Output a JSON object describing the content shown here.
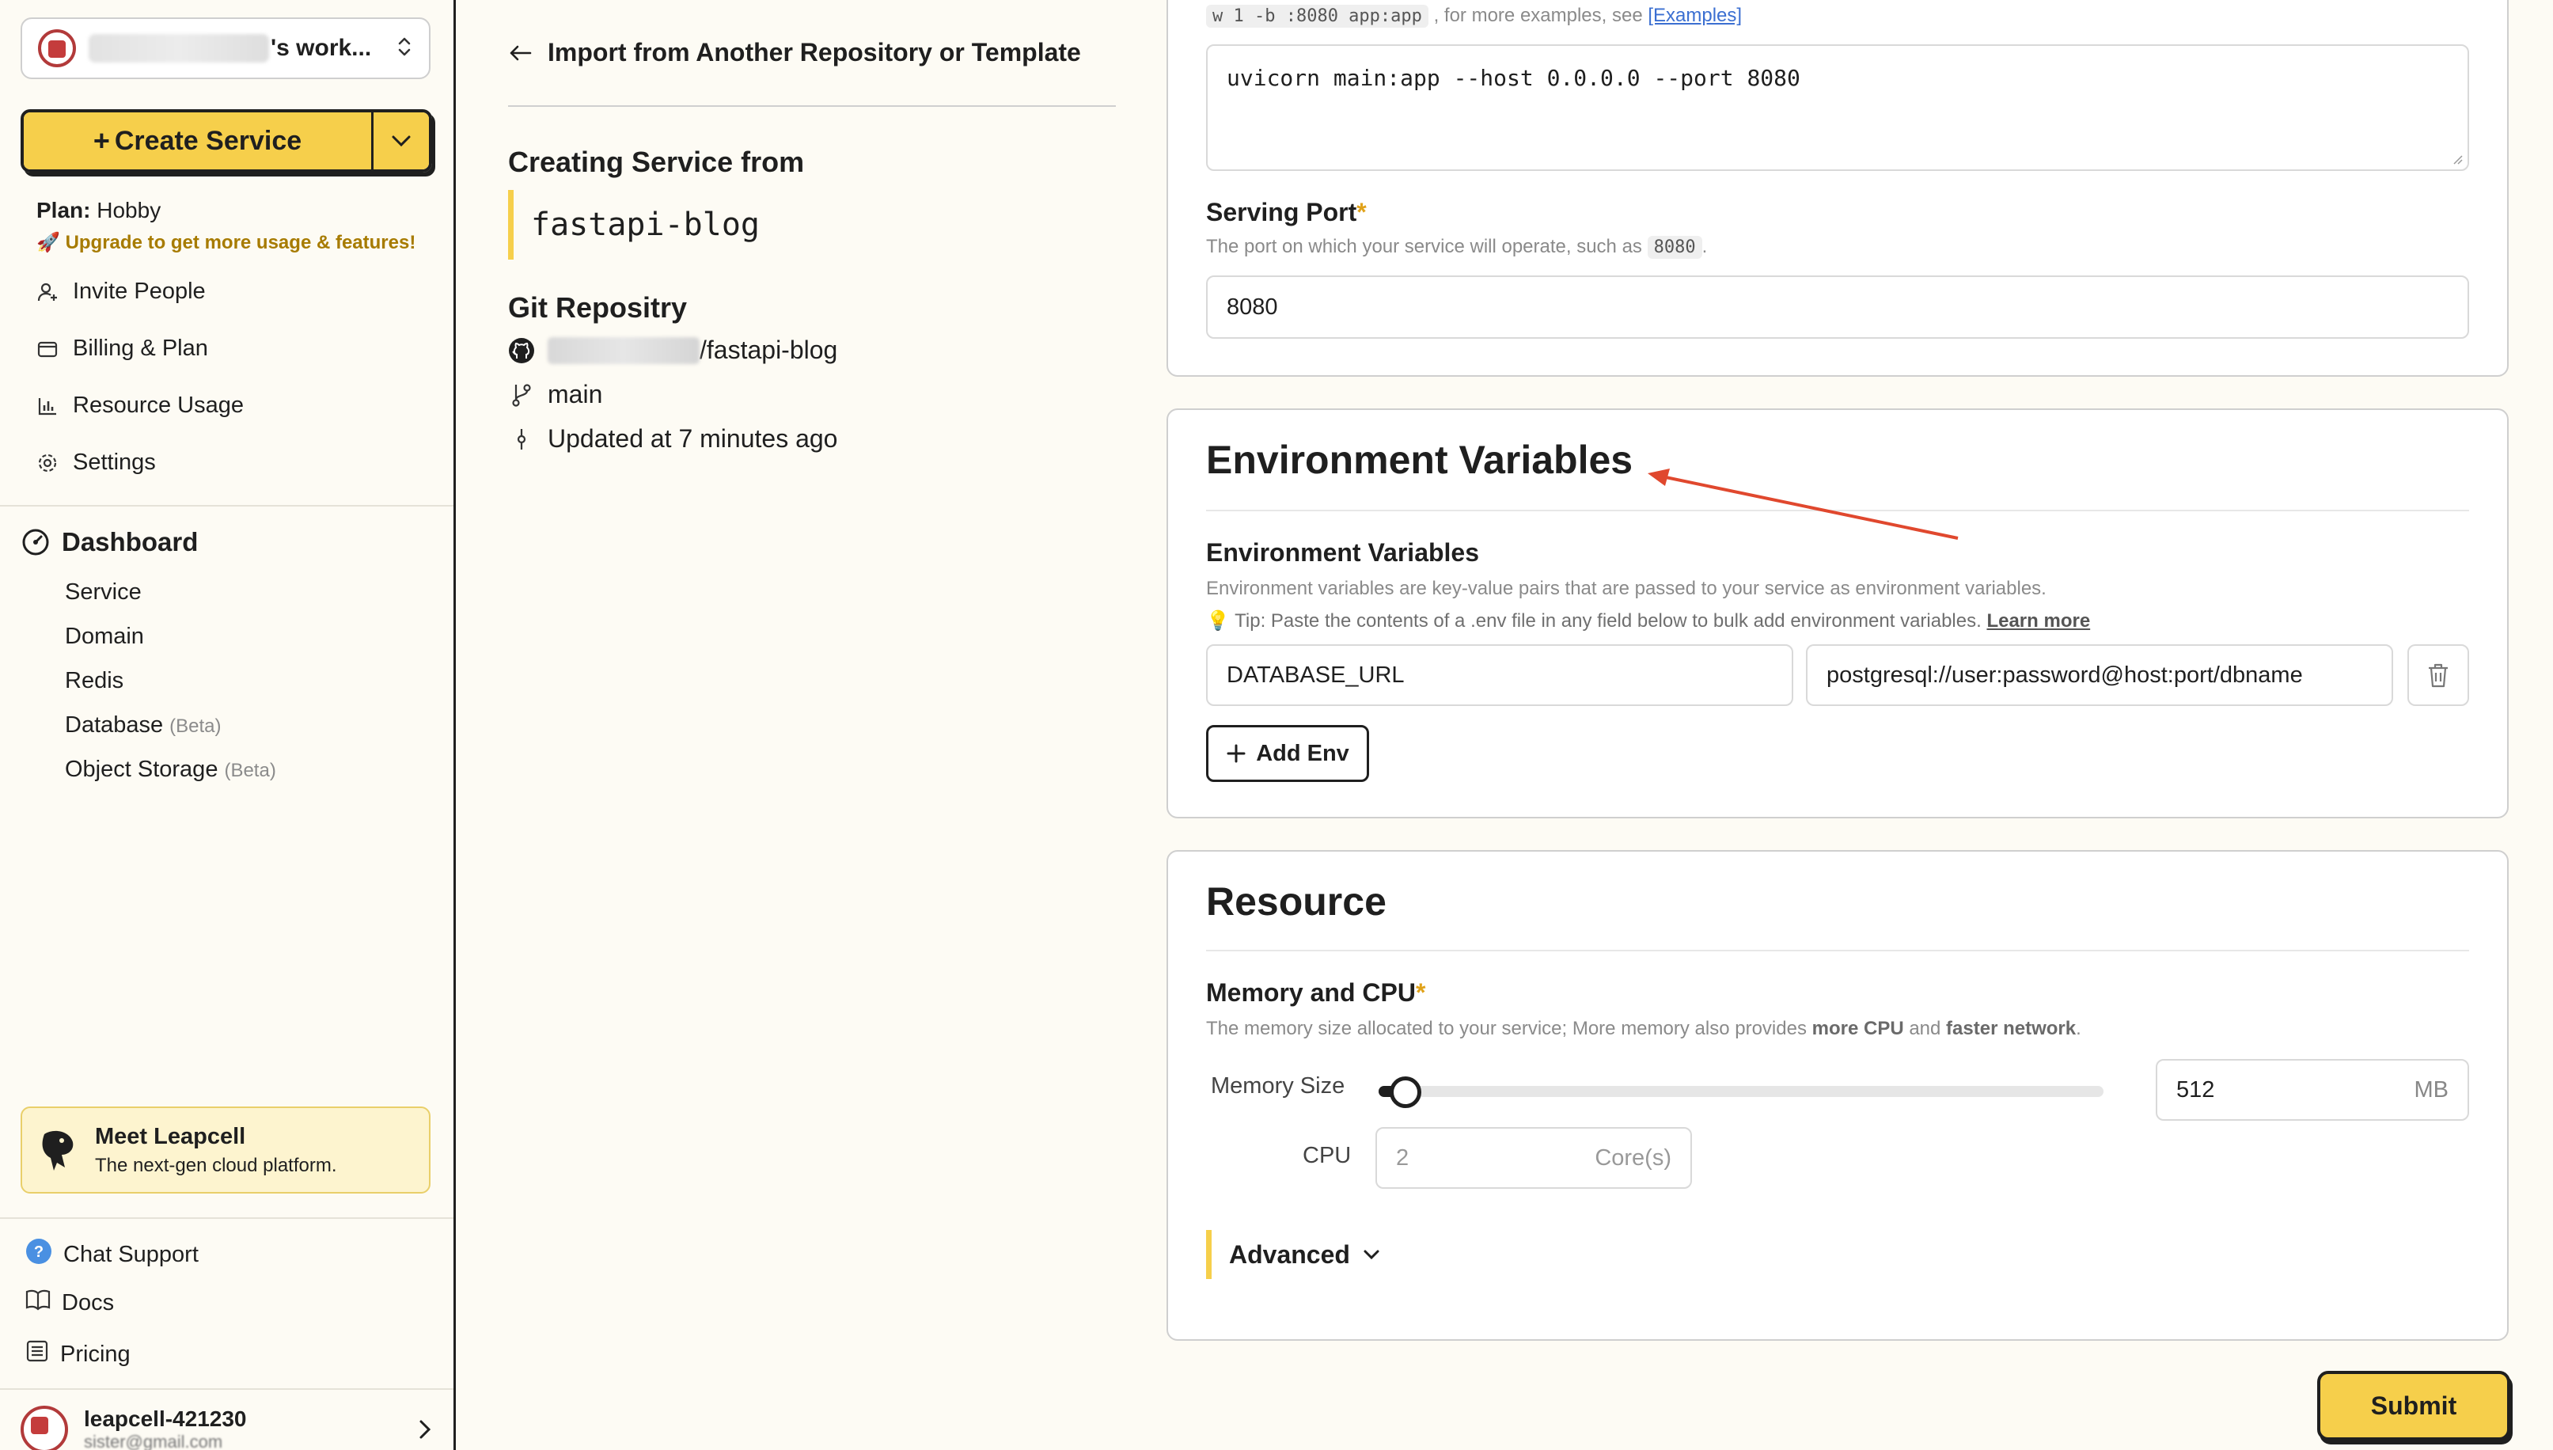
{
  "sidebar": {
    "workspace_suffix": "'s work...",
    "create_service_label": "Create Service",
    "plan_label": "Plan:",
    "plan_value": "Hobby",
    "upgrade_text": "Upgrade to get more usage & features!",
    "account_items": [
      {
        "label": "Invite People",
        "icon": "user-plus-icon"
      },
      {
        "label": "Billing & Plan",
        "icon": "wallet-icon"
      },
      {
        "label": "Resource Usage",
        "icon": "bar-chart-icon"
      },
      {
        "label": "Settings",
        "icon": "gear-icon"
      }
    ],
    "dashboard_title": "Dashboard",
    "dashboard_items": [
      {
        "label": "Service",
        "badge": ""
      },
      {
        "label": "Domain",
        "badge": ""
      },
      {
        "label": "Redis",
        "badge": ""
      },
      {
        "label": "Database",
        "badge": "(Beta)"
      },
      {
        "label": "Object Storage",
        "badge": "(Beta)"
      }
    ],
    "promo": {
      "title": "Meet Leapcell",
      "subtitle": "The next-gen cloud platform."
    },
    "bottom_items": [
      {
        "label": "Chat Support",
        "icon": "help-icon"
      },
      {
        "label": "Docs",
        "icon": "book-icon"
      },
      {
        "label": "Pricing",
        "icon": "list-icon"
      }
    ],
    "user": {
      "name": "leapcell-421230",
      "email": "sister@gmail.com"
    }
  },
  "middle": {
    "back_label": "Import from Another Repository or Template",
    "creating_title": "Creating Service from",
    "service_name": "fastapi-blog",
    "git_title": "Git Repositry",
    "repo_suffix": "/fastapi-blog",
    "branch": "main",
    "updated": "Updated at 7 minutes ago"
  },
  "start_command": {
    "hint_code": "w 1 -b :8080 app:app",
    "hint_text": ", for more examples, see",
    "hint_link": "[Examples]",
    "value": "uvicorn main:app --host 0.0.0.0 --port 8080"
  },
  "serving_port": {
    "label": "Serving Port",
    "required_mark": "*",
    "hint": "The port on which your service will operate, such as",
    "hint_code": "8080",
    "value": "8080"
  },
  "env_section": {
    "title": "Environment Variables",
    "subtitle": "Environment Variables",
    "description": "Environment variables are key-value pairs that are passed to your service as environment variables.",
    "tip": "Tip: Paste the contents of a .env file in any field below to bulk add environment variables.",
    "tip_link": "Learn more",
    "rows": [
      {
        "key": "DATABASE_URL",
        "value": "postgresql://user:password@host:port/dbname"
      }
    ],
    "add_label": "Add Env"
  },
  "resource_section": {
    "title": "Resource",
    "memory_cpu_label": "Memory and CPU",
    "required_mark": "*",
    "desc_prefix": "The memory size allocated to your service; More memory also provides",
    "desc_bold1": "more CPU",
    "desc_mid": "and",
    "desc_bold2": "faster network",
    "desc_suffix": ".",
    "memory_label": "Memory Size",
    "memory_value": "512",
    "memory_unit": "MB",
    "memory_slider_fraction": 0.02,
    "cpu_label": "CPU",
    "cpu_value": "2",
    "cpu_unit": "Core(s)",
    "advanced_label": "Advanced"
  },
  "submit_label": "Submit",
  "colors": {
    "accent": "#f6cf4b",
    "annotation_arrow": "#e0482e"
  }
}
